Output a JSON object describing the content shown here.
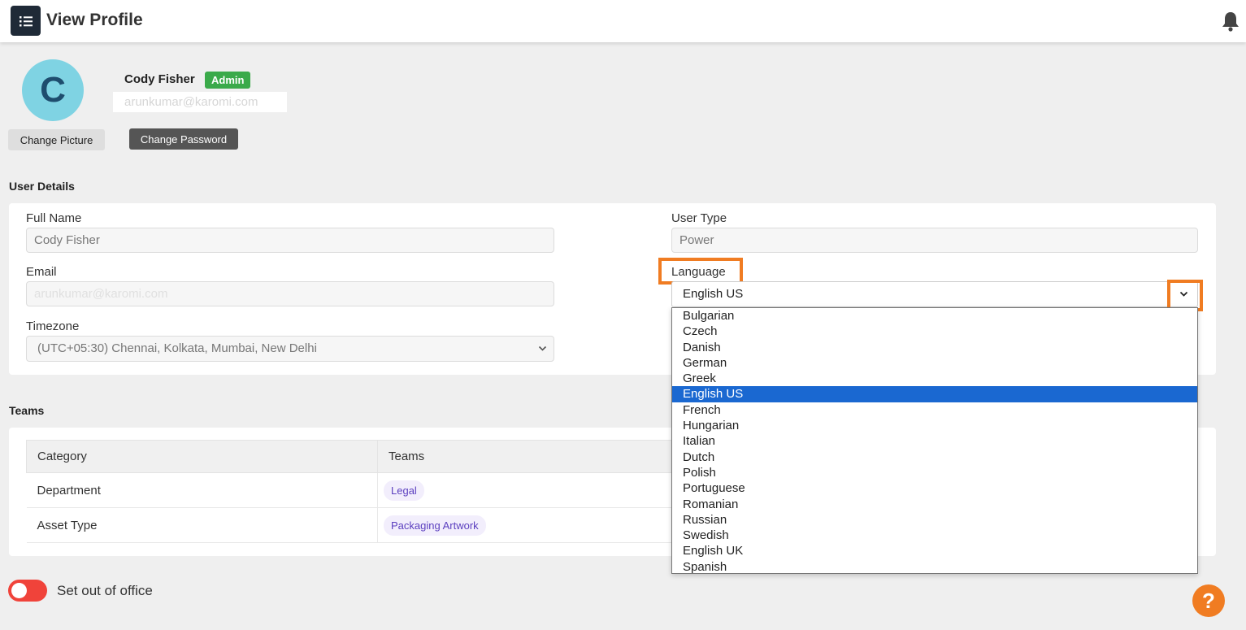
{
  "header": {
    "title": "View Profile",
    "menu_icon": "list-icon",
    "notification_icon": "bell-icon"
  },
  "profile": {
    "avatar_letter": "C",
    "name": "Cody Fisher",
    "role_badge": "Admin",
    "email": "arunkumar@karomi.com",
    "change_picture_label": "Change Picture",
    "change_password_label": "Change Password"
  },
  "user_details": {
    "section_title": "User Details",
    "full_name_label": "Full Name",
    "full_name_value": "Cody Fisher",
    "email_label": "Email",
    "email_value": "arunkumar@karomi.com",
    "timezone_label": "Timezone",
    "timezone_value": "(UTC+05:30) Chennai, Kolkata, Mumbai, New Delhi",
    "user_type_label": "User Type",
    "user_type_value": "Power",
    "language_label": "Language",
    "language_value": "English US",
    "language_options": [
      "Bulgarian",
      "Czech",
      "Danish",
      "German",
      "Greek",
      "English US",
      "French",
      "Hungarian",
      "Italian",
      "Dutch",
      "Polish",
      "Portuguese",
      "Romanian",
      "Russian",
      "Swedish",
      "English UK",
      "Spanish"
    ]
  },
  "teams": {
    "section_title": "Teams",
    "columns": [
      "Category",
      "Teams"
    ],
    "rows": [
      {
        "category": "Department",
        "team": "Legal"
      },
      {
        "category": "Asset Type",
        "team": "Packaging Artwork"
      }
    ]
  },
  "out_of_office": {
    "label": "Set out of office"
  },
  "help": {
    "label": "?"
  },
  "colors": {
    "accent": "#f07c22",
    "selected": "#1a68d1",
    "badge": "#3aaa4a",
    "toggle": "#f0433a"
  }
}
